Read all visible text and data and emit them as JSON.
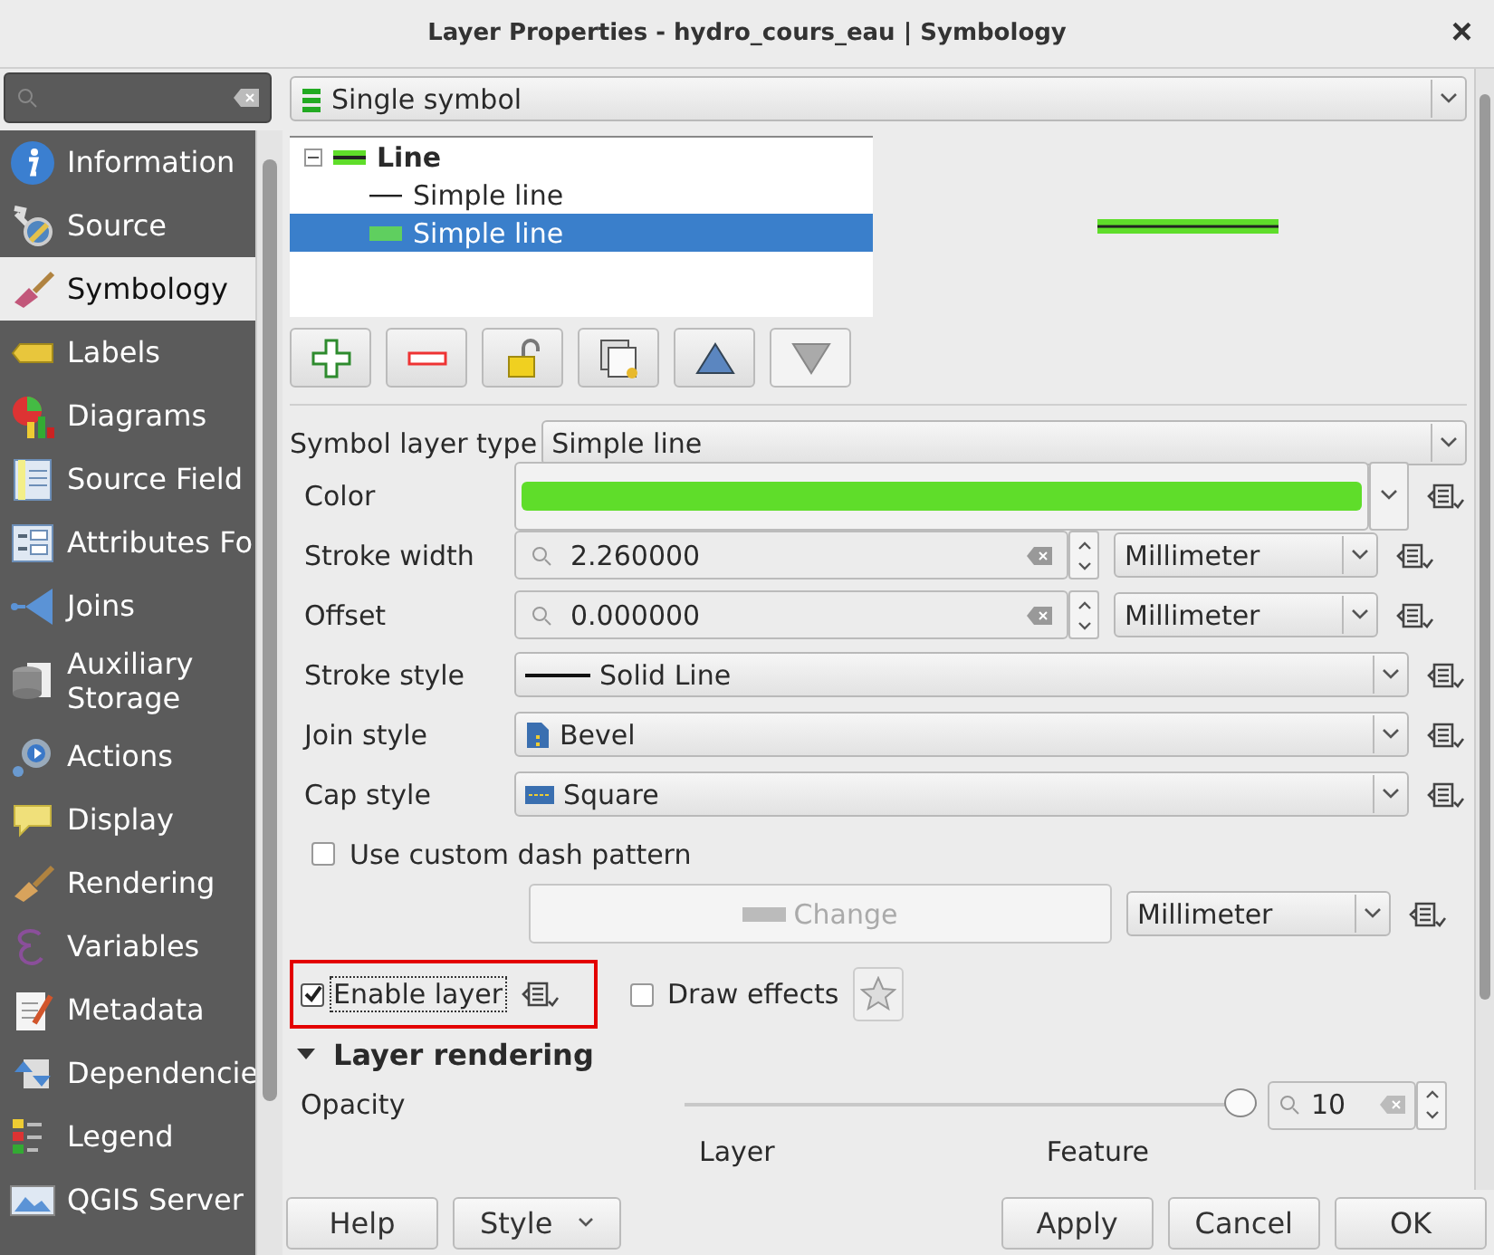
{
  "window": {
    "title": "Layer Properties - hydro_cours_eau | Symbology",
    "close": "×"
  },
  "sidebar": {
    "items": [
      {
        "label": "Information",
        "selected": false
      },
      {
        "label": "Source",
        "selected": false
      },
      {
        "label": "Symbology",
        "selected": true
      },
      {
        "label": "Labels",
        "selected": false
      },
      {
        "label": "Diagrams",
        "selected": false
      },
      {
        "label": "Source Field",
        "selected": false
      },
      {
        "label": "Attributes Fo",
        "selected": false
      },
      {
        "label": "Joins",
        "selected": false
      },
      {
        "label": "Auxiliary Storage",
        "selected": false
      },
      {
        "label": "Actions",
        "selected": false
      },
      {
        "label": "Display",
        "selected": false
      },
      {
        "label": "Rendering",
        "selected": false
      },
      {
        "label": "Variables",
        "selected": false
      },
      {
        "label": "Metadata",
        "selected": false
      },
      {
        "label": "Dependencie",
        "selected": false
      },
      {
        "label": "Legend",
        "selected": false
      },
      {
        "label": "QGIS Server",
        "selected": false
      }
    ]
  },
  "renderer": "Single symbol",
  "symbol_tree": [
    {
      "label": "Line",
      "expanded": true,
      "selected": false,
      "children": [
        {
          "label": "Simple line",
          "selected": false
        },
        {
          "label": "Simple line",
          "selected": true
        }
      ]
    }
  ],
  "symbol_layer_buttons": [
    {
      "disabled": false
    },
    {
      "disabled": false
    },
    {
      "disabled": false
    },
    {
      "disabled": false
    },
    {
      "disabled": false
    },
    {
      "disabled": true
    }
  ],
  "symbol_layer_type": {
    "label": "Symbol layer type",
    "value": "Simple line"
  },
  "properties": [
    {
      "kind": "color",
      "label": "Color",
      "color": "#5fdd2a"
    },
    {
      "kind": "spin",
      "label": "Stroke width",
      "value": "2.260000",
      "unit": "Millimeter"
    },
    {
      "kind": "spin",
      "label": "Offset",
      "value": "0.000000",
      "unit": "Millimeter"
    },
    {
      "kind": "combo",
      "label": "Stroke style",
      "value": "Solid Line"
    },
    {
      "kind": "combo",
      "label": "Join style",
      "value": "Bevel"
    },
    {
      "kind": "combo",
      "label": "Cap style",
      "value": "Square"
    },
    {
      "kind": "checkbox",
      "label": "Use custom dash pattern",
      "checked": false
    },
    {
      "kind": "button",
      "label": "Change",
      "disabled": true,
      "unit": "Millimeter"
    }
  ],
  "enable_layer": {
    "label": "Enable layer",
    "checked": true,
    "highlighted": true
  },
  "draw_effects": {
    "label": "Draw effects",
    "checked": false
  },
  "layer_rendering": {
    "title": "Layer rendering",
    "expanded": true,
    "opacity": {
      "label": "Opacity",
      "level": 1,
      "value": "10"
    },
    "column_labels": [
      "Layer",
      "Feature"
    ]
  },
  "buttons": [
    {
      "label": "Help",
      "kind": "plain"
    },
    {
      "label": "Style",
      "kind": "menu"
    },
    {
      "label": "Apply",
      "kind": "plain"
    },
    {
      "label": "Cancel",
      "kind": "plain"
    },
    {
      "label": "OK",
      "kind": "plain"
    }
  ]
}
